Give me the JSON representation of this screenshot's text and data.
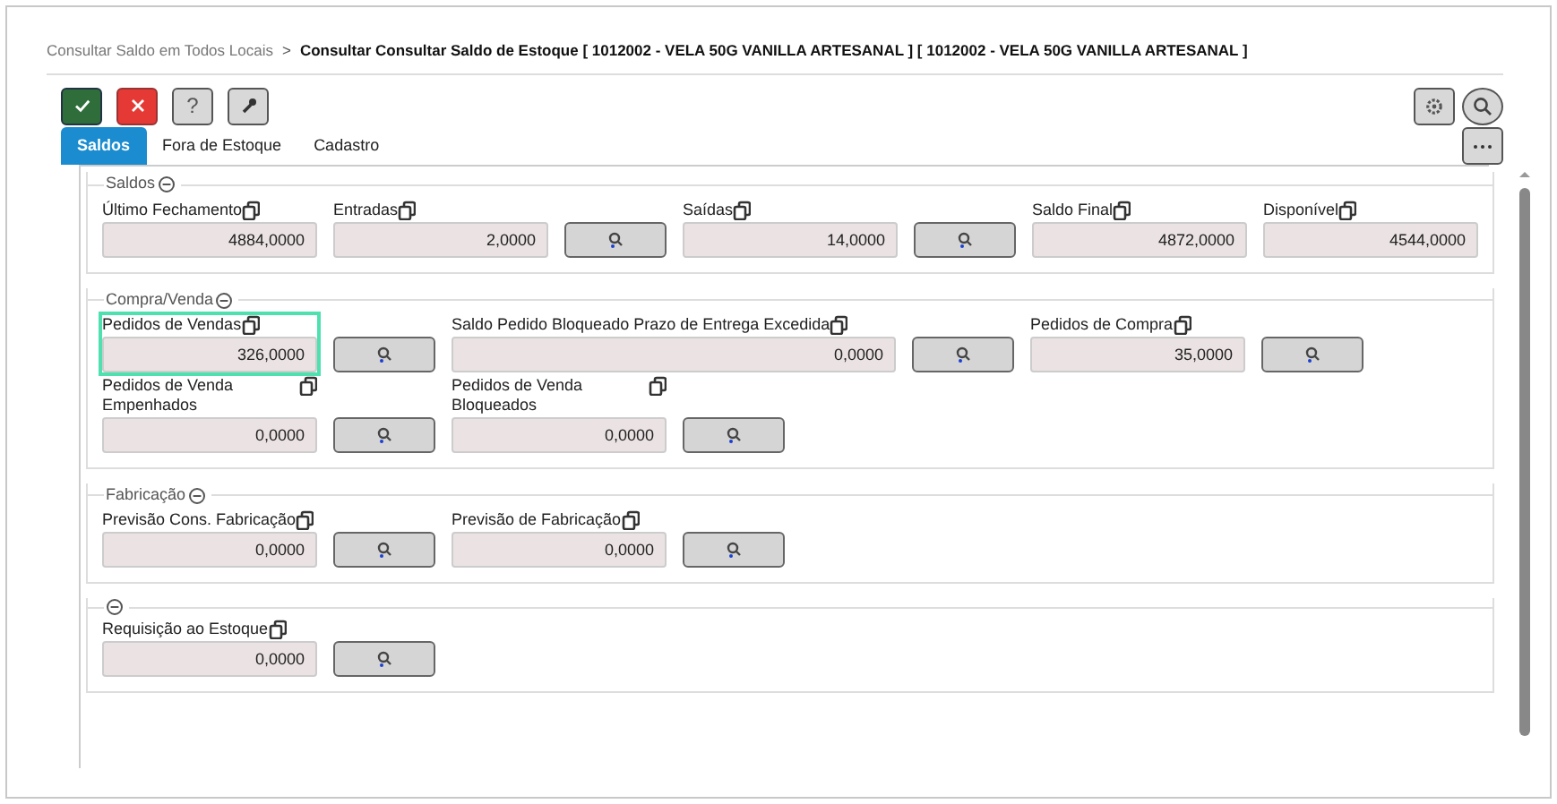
{
  "breadcrumb": {
    "parent": "Consultar Saldo em Todos Locais",
    "separator": ">",
    "current": "Consultar Consultar Saldo de Estoque [ 1012002 - VELA 50G VANILLA ARTESANAL ] [ 1012002 - VELA 50G VANILLA ARTESANAL ]"
  },
  "toolbar": [
    {
      "kind": "confirm"
    },
    {
      "kind": "cancel"
    },
    {
      "kind": "help",
      "label": "?"
    },
    {
      "kind": "tools"
    }
  ],
  "tabs": [
    {
      "label": "Saldos",
      "selected": true
    },
    {
      "label": "Fora de Estoque",
      "selected": false
    },
    {
      "label": "Cadastro",
      "selected": false
    }
  ],
  "sections": [
    {
      "title": "Saldos",
      "rows": [
        [
          {
            "kind": "field",
            "label": "Último Fechamento",
            "value": "4884,0000",
            "focused": false
          },
          {
            "kind": "field",
            "label": "Entradas",
            "value": "2,0000",
            "focused": false
          },
          {
            "kind": "lookup"
          },
          {
            "kind": "field",
            "label": "Saídas",
            "value": "14,0000",
            "focused": false
          },
          {
            "kind": "lookup"
          },
          {
            "kind": "field",
            "label": "Saldo Final",
            "value": "4872,0000",
            "focused": false
          },
          {
            "kind": "field",
            "label": "Disponível",
            "value": "4544,0000",
            "focused": false
          }
        ]
      ]
    },
    {
      "title": "Compra/Venda",
      "rows": [
        [
          {
            "kind": "field",
            "label": "Pedidos de Vendas",
            "value": "326,0000",
            "focused": true
          },
          {
            "kind": "lookup"
          },
          {
            "kind": "wide-field",
            "label": "Saldo Pedido Bloqueado Prazo de Entrega Excedida",
            "value": "0,0000",
            "focused": false
          },
          {
            "kind": "lookup"
          },
          {
            "kind": "field",
            "label": "Pedidos de Compra",
            "value": "35,0000",
            "focused": false
          },
          {
            "kind": "lookup"
          }
        ],
        [
          {
            "kind": "field",
            "label": "Pedidos de Venda Empenhados",
            "value": "0,0000",
            "focused": false
          },
          {
            "kind": "lookup"
          },
          {
            "kind": "field",
            "label": "Pedidos de Venda Bloqueados",
            "value": "0,0000",
            "focused": false
          },
          {
            "kind": "lookup"
          }
        ]
      ]
    },
    {
      "title": "Fabricação",
      "rows": [
        [
          {
            "kind": "field",
            "label": "Previsão Cons. Fabricação",
            "value": "0,0000",
            "focused": false
          },
          {
            "kind": "lookup"
          },
          {
            "kind": "field",
            "label": "Previsão de Fabricação",
            "value": "0,0000",
            "focused": false
          },
          {
            "kind": "lookup"
          }
        ]
      ]
    },
    {
      "rows": [
        [
          {
            "kind": "field",
            "label": "Requisição ao Estoque",
            "value": "0,0000",
            "focused": false
          },
          {
            "kind": "lookup"
          }
        ]
      ]
    }
  ]
}
